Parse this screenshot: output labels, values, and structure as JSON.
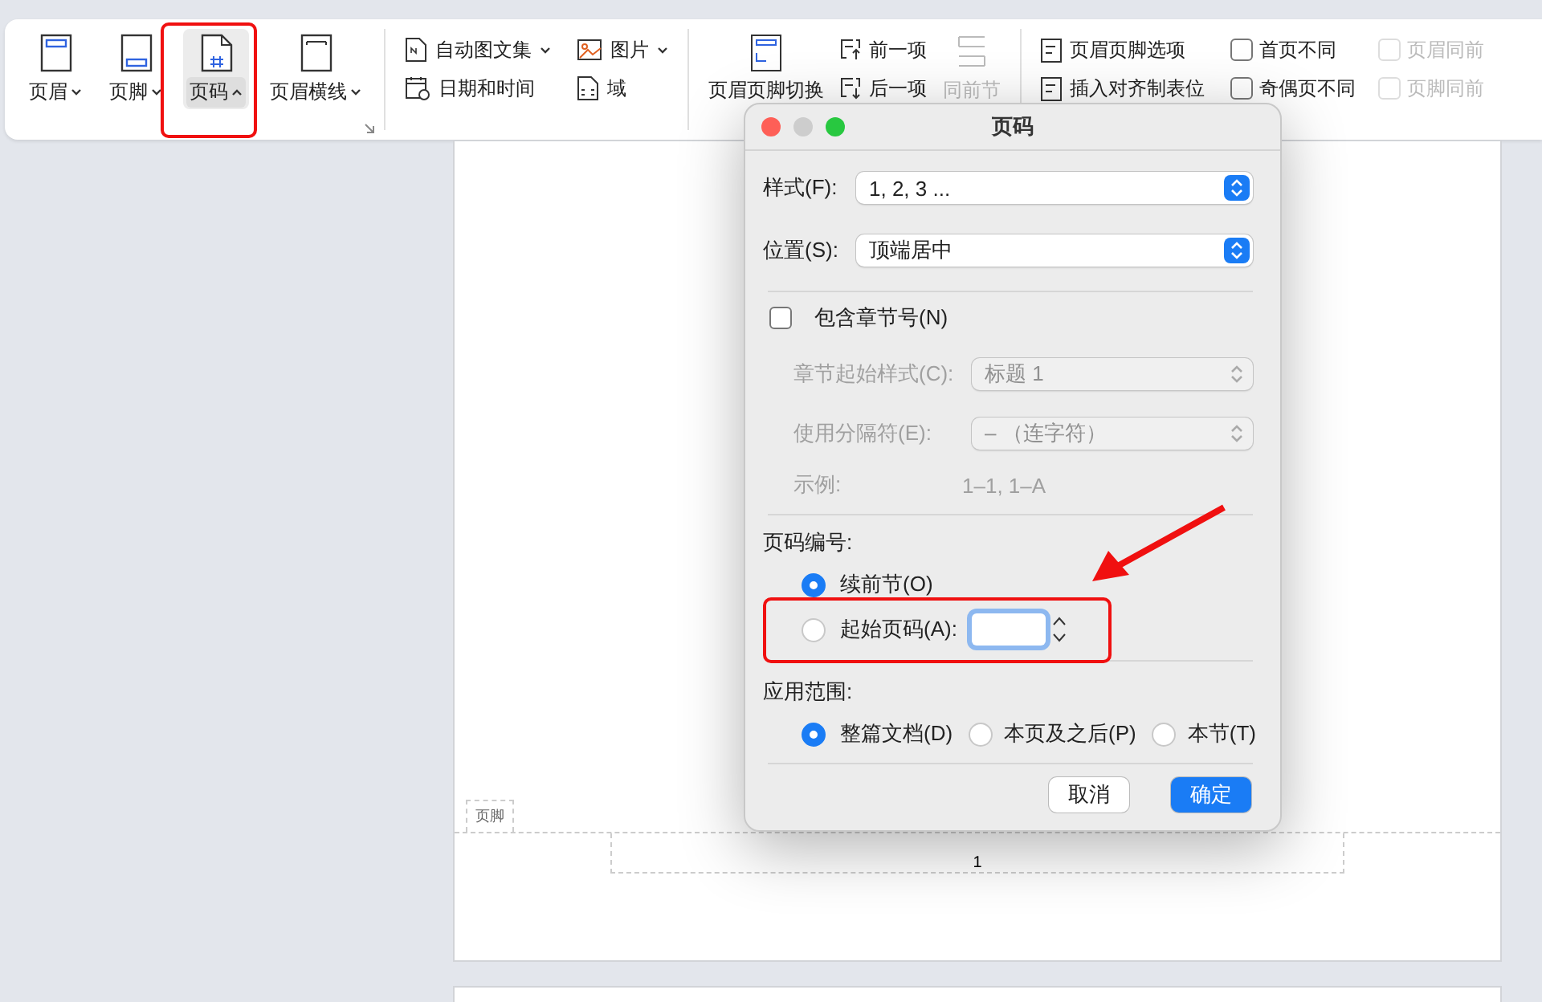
{
  "ribbon": {
    "header_buttons": [
      {
        "label": "页眉",
        "selected": false,
        "kind": "header"
      },
      {
        "label": "页脚",
        "selected": false,
        "kind": "footer"
      },
      {
        "label": "页码",
        "selected": true,
        "kind": "number"
      },
      {
        "label": "页眉横线",
        "selected": false,
        "kind": "rule"
      }
    ],
    "insert_items": [
      {
        "label": "自动图文集",
        "dropdown": true,
        "kind": "autotext"
      },
      {
        "label": "日期和时间",
        "dropdown": false,
        "kind": "date"
      },
      {
        "label": "图片",
        "dropdown": true,
        "kind": "picture"
      },
      {
        "label": "域",
        "dropdown": false,
        "kind": "field"
      }
    ],
    "switch_button": {
      "label": "页眉页脚切换"
    },
    "nav_items": [
      {
        "label": "前一项"
      },
      {
        "label": "后一项"
      }
    ],
    "link_button": {
      "label": "同前节",
      "disabled": true
    },
    "option_items": [
      {
        "label": "页眉页脚选项"
      },
      {
        "label": "插入对齐制表位"
      }
    ],
    "checkboxes": [
      {
        "label": "首页不同",
        "checked": false,
        "disabled": false
      },
      {
        "label": "奇偶页不同",
        "checked": false,
        "disabled": false
      },
      {
        "label": "页眉同前",
        "checked": false,
        "disabled": true
      },
      {
        "label": "页脚同前",
        "checked": false,
        "disabled": true
      }
    ]
  },
  "dialog": {
    "title": "页码",
    "selects": [
      {
        "label": "样式(F):",
        "value": "1, 2, 3 ..."
      },
      {
        "label": "位置(S):",
        "value": "顶端居中"
      }
    ],
    "include_chapter": {
      "label": "包含章节号(N)",
      "checked": false
    },
    "chapter_fields": [
      {
        "label": "章节起始样式(C):",
        "value": "标题 1",
        "disabled": true
      },
      {
        "label": "使用分隔符(E):",
        "value": "–   （连字符）",
        "disabled": true
      }
    ],
    "example": {
      "label": "示例:",
      "value": "1–1, 1–A"
    },
    "numbering": {
      "heading": "页码编号:",
      "options": [
        {
          "label": "续前节(O)",
          "selected": true
        },
        {
          "label": "起始页码(A):",
          "selected": false
        }
      ]
    },
    "apply": {
      "heading": "应用范围:",
      "options": [
        {
          "label": "整篇文档(D)",
          "selected": true
        },
        {
          "label": "本页及之后(P)",
          "selected": false
        },
        {
          "label": "本节(T)",
          "selected": false
        }
      ]
    },
    "buttons": [
      {
        "label": "取消",
        "kind": "secondary"
      },
      {
        "label": "确定",
        "kind": "primary"
      }
    ]
  },
  "document": {
    "footer_tag": "页脚",
    "page_number": "1"
  }
}
